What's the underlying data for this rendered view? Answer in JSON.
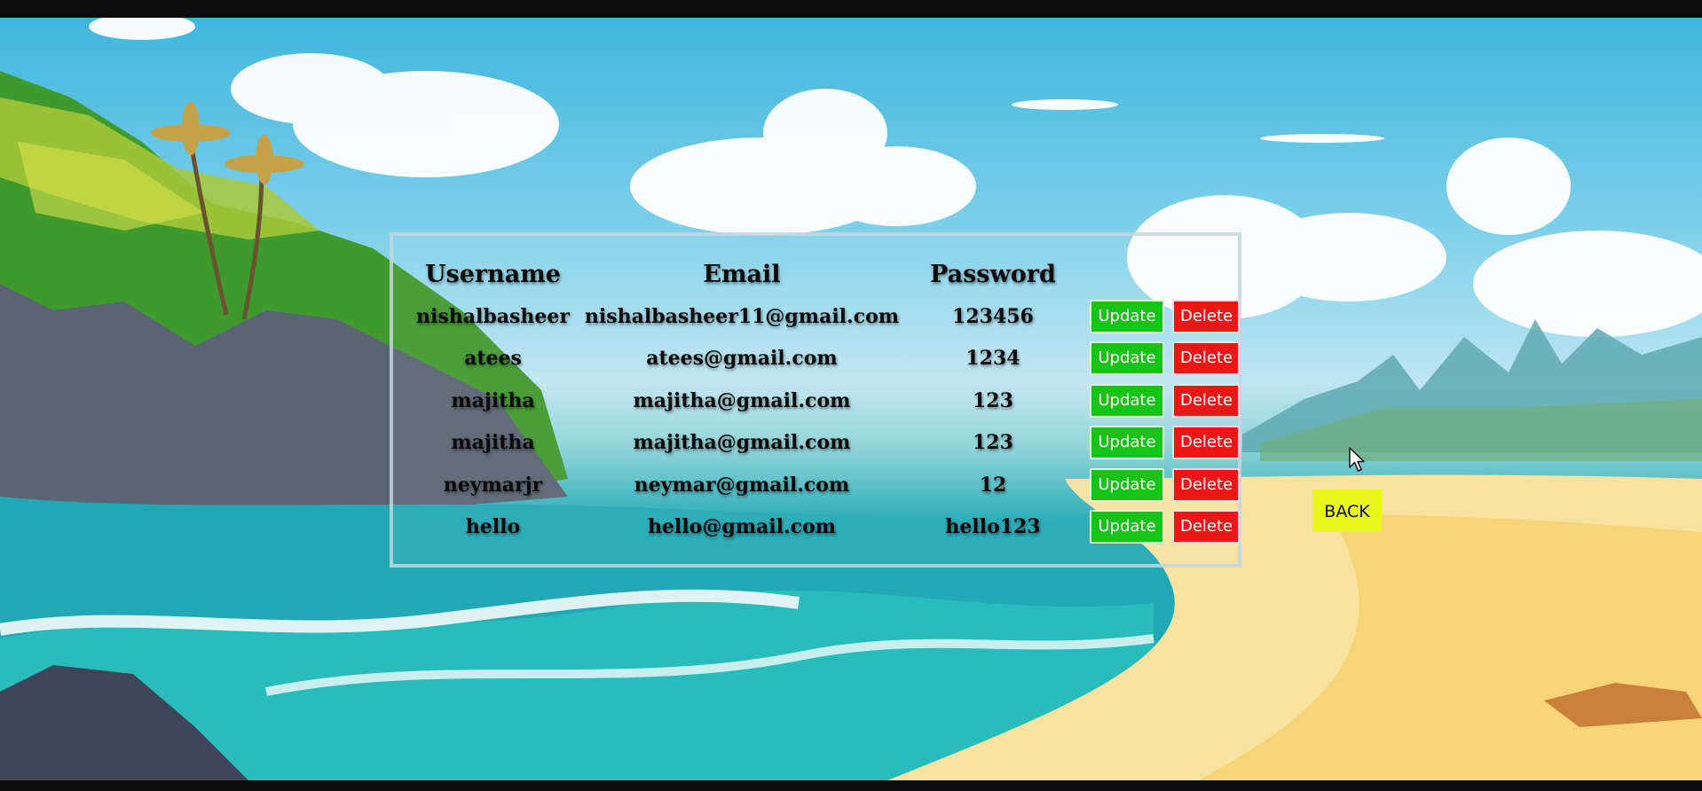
{
  "table": {
    "headers": {
      "username": "Username",
      "email": "Email",
      "password": "Password"
    },
    "rows": [
      {
        "username": "nishalbasheer",
        "email": "nishalbasheer11@gmail.com",
        "password": "123456",
        "update_label": "Update",
        "delete_label": "Delete"
      },
      {
        "username": "atees",
        "email": "atees@gmail.com",
        "password": "1234",
        "update_label": "Update",
        "delete_label": "Delete"
      },
      {
        "username": "majitha",
        "email": "majitha@gmail.com",
        "password": "123",
        "update_label": "Update",
        "delete_label": "Delete"
      },
      {
        "username": "majitha",
        "email": "majitha@gmail.com",
        "password": "123",
        "update_label": "Update",
        "delete_label": "Delete"
      },
      {
        "username": "neymarjr",
        "email": "neymar@gmail.com",
        "password": "12",
        "update_label": "Update",
        "delete_label": "Delete"
      },
      {
        "username": "hello",
        "email": "hello@gmail.com",
        "password": "hello123",
        "update_label": "Update",
        "delete_label": "Delete"
      }
    ]
  },
  "back_label": "BACK",
  "colors": {
    "update": "#18c318",
    "delete": "#ea1717",
    "back": "#e8f71d"
  },
  "icons": {
    "cursor": "mouse-pointer-icon"
  }
}
